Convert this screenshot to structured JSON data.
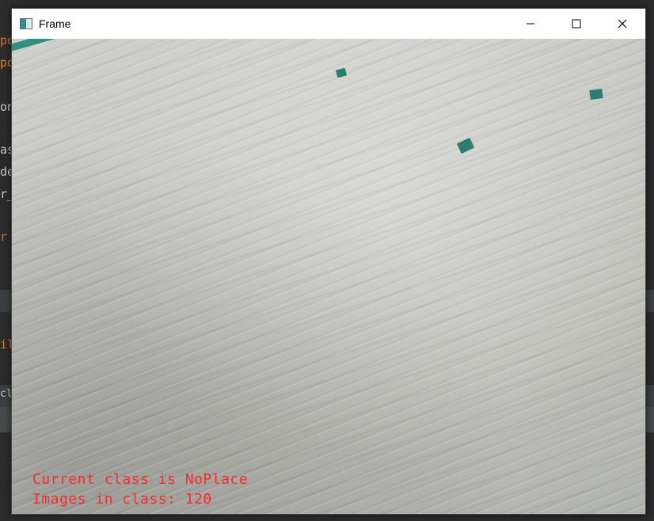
{
  "window": {
    "title": "Frame",
    "icon": "app-window-icon",
    "controls": [
      "minimize-icon",
      "maximize-icon",
      "close-icon"
    ]
  },
  "overlay": {
    "line1": "Current class is NoPlace",
    "line2": "Images in class: 120"
  },
  "background_editor": {
    "lines": [
      "po",
      "po",
      "po",
      "on",
      "as",
      "de",
      "r_",
      "r",
      "il",
      "cl"
    ]
  },
  "colors": {
    "overlay_text": "#ff2a2a",
    "marker": "#2a7d72",
    "editor_bg": "#2b2b2b"
  }
}
